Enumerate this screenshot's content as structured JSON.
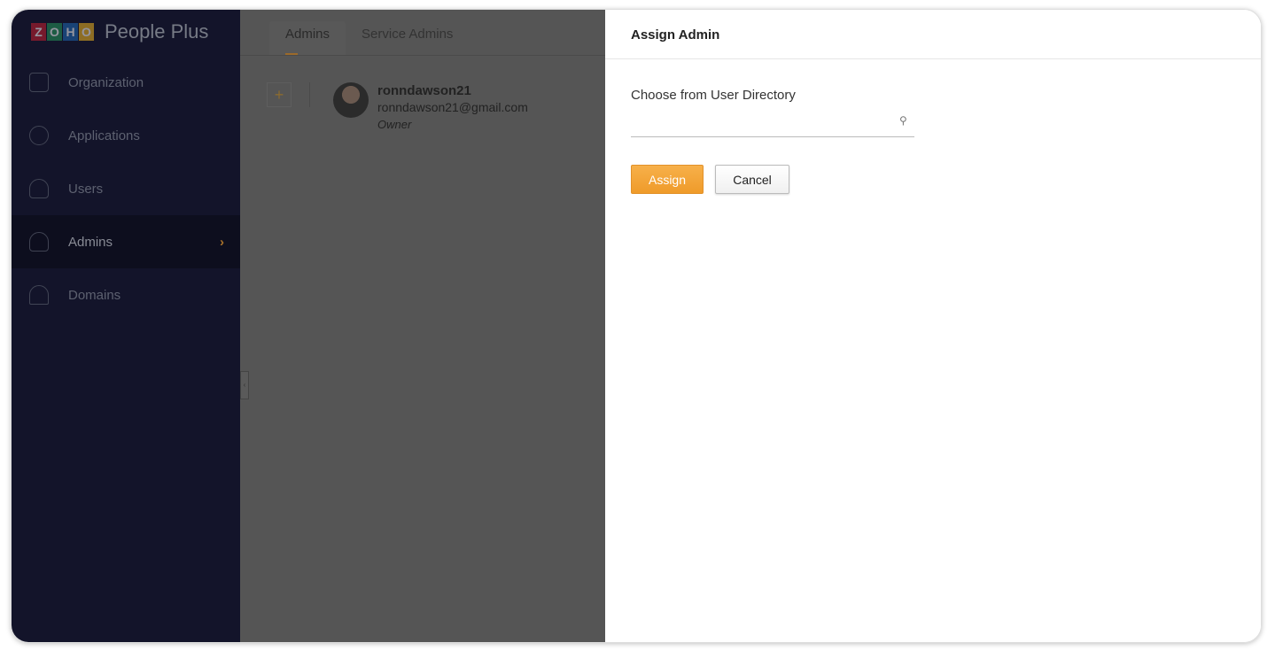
{
  "app": {
    "logo_letters": [
      "Z",
      "O",
      "H",
      "O"
    ],
    "logo_colors": [
      "#c8202f",
      "#27975a",
      "#1f6bb4",
      "#f3b720"
    ],
    "brand": "People Plus"
  },
  "sidebar": {
    "items": [
      {
        "label": "Organization",
        "icon": "building-icon"
      },
      {
        "label": "Applications",
        "icon": "apps-grid-icon"
      },
      {
        "label": "Users",
        "icon": "user-icon"
      },
      {
        "label": "Admins",
        "icon": "admin-icon",
        "active": true
      },
      {
        "label": "Domains",
        "icon": "www-icon"
      }
    ]
  },
  "main": {
    "tabs": [
      {
        "label": "Admins",
        "active": true
      },
      {
        "label": "Service Admins"
      }
    ],
    "add_label": "+",
    "admin": {
      "name": "ronndawson21",
      "email": "ronndawson21@gmail.com",
      "role": "Owner"
    }
  },
  "panel": {
    "title": "Assign Admin",
    "field_label": "Choose from User Directory",
    "field_value": "",
    "assign": "Assign",
    "cancel": "Cancel"
  },
  "colors": {
    "accent": "#f0a23a",
    "sidebar": "#13142a"
  }
}
